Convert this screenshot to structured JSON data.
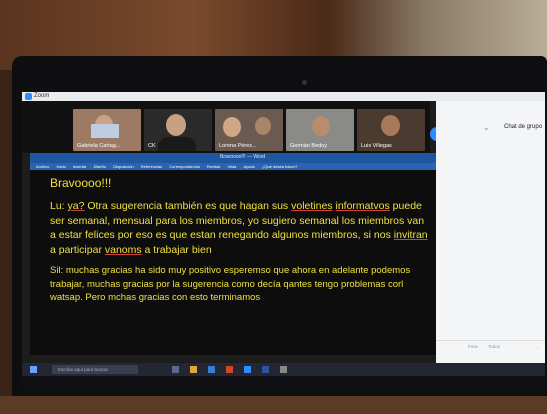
{
  "window": {
    "app_title": "Zoom"
  },
  "participants": [
    {
      "name": "Gabriela Cartag..."
    },
    {
      "name": "CK"
    },
    {
      "name": "Lorena Pérez..."
    },
    {
      "name": "Germán Bedoy"
    },
    {
      "name": "Luis Villegas"
    }
  ],
  "shared_doc": {
    "title": "Bravoooo!!! — Word",
    "ribbon": [
      "Archivo",
      "Inicio",
      "Insertar",
      "Diseño",
      "Disposición",
      "Referencias",
      "Correspondencia",
      "Revisar",
      "Vista",
      "Ayuda",
      "¿Qué desea hacer?"
    ],
    "heading": "Bravoooo!!!",
    "lu_speaker": "Lu:",
    "lu_ya": "ya?",
    "lu_text_1": " Otra sugerencia también es que hagan sus ",
    "lu_voletines": "voletines",
    "lu_informatvos": "informatvos",
    "lu_text_2": " puede ser semanal, mensual para los miembros, yo sugiero semanal los miembros van a estar felices por eso es que estan renegando algunos miembros, si nos ",
    "lu_invitran": "invitran",
    "lu_text_3": " a participar ",
    "lu_vanoms": "vanoms",
    "lu_text_4": " a trabajar bien",
    "sil_speaker": "Sil:",
    "sil_text_1": " muchas gracias ha sido muy positivo ",
    "sil_esperemso": "esperemso",
    "sil_text_2": " que ahora en adelante podemos trabajar, muchas gracias por la sugerencia como decía ",
    "sil_qantes": "qantes",
    "sil_text_3": " tengo problemas ",
    "sil_corl": "corl",
    "sil_text_4": " watsap. Pero ",
    "sil_mchas": "mchas",
    "sil_text_5": " gracias con esto terminamos"
  },
  "chat": {
    "title": "Chat de grupo",
    "foot_left": "Para:",
    "foot_right": "Todos",
    "messages": [
      "",
      "",
      "",
      "",
      "",
      "",
      "",
      "",
      "",
      ""
    ]
  },
  "taskbar": {
    "search_placeholder": "Escribe aquí para buscar",
    "clock": ""
  },
  "colors": {
    "zoom_blue": "#2d8cff",
    "doc_text": "#f0e040",
    "word_blue": "#1e56a0"
  }
}
